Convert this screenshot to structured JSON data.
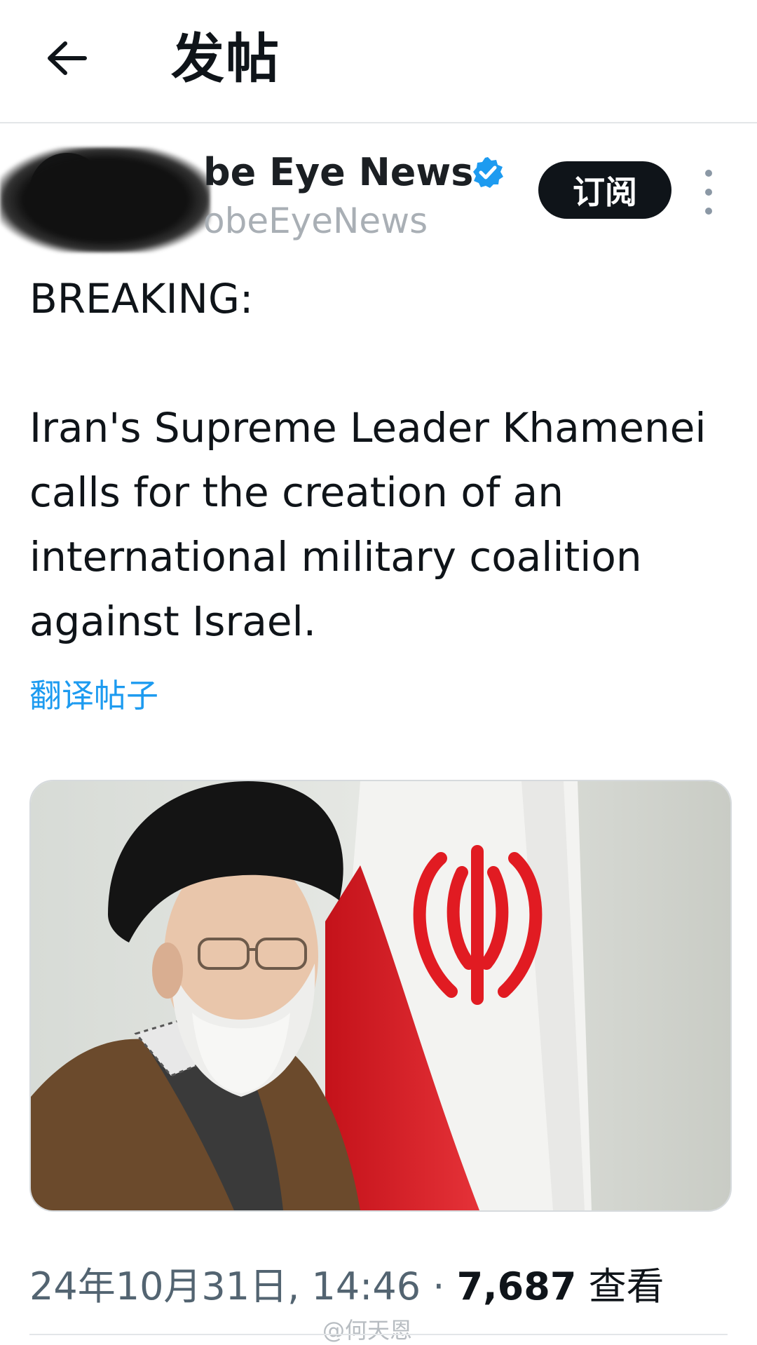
{
  "header": {
    "title": "发帖",
    "back_icon": "back-arrow-icon"
  },
  "author": {
    "display_name_visible": "be Eye News",
    "display_name_faded_prefix": "",
    "handle_visible": "obeEyeNews",
    "verified_icon": "verified-badge-icon",
    "subscribe_label": "订阅",
    "more_icon": "more-options-icon"
  },
  "post": {
    "line1": "BREAKING:",
    "body": "Iran's Supreme Leader Khamenei calls for the creation of an international military coalition against Israel.",
    "translate_label": "翻译帖子"
  },
  "meta": {
    "timestamp": "24年10月31日, 14:46",
    "separator": " · ",
    "views_count": "7,687",
    "views_label": "查看"
  },
  "watermark": "@何天恩",
  "colors": {
    "link": "#1d9bf0",
    "verified": "#1d9bf0",
    "button_bg": "#0f1419",
    "flag_red": "#e11b22",
    "flag_green": "#239f40"
  }
}
